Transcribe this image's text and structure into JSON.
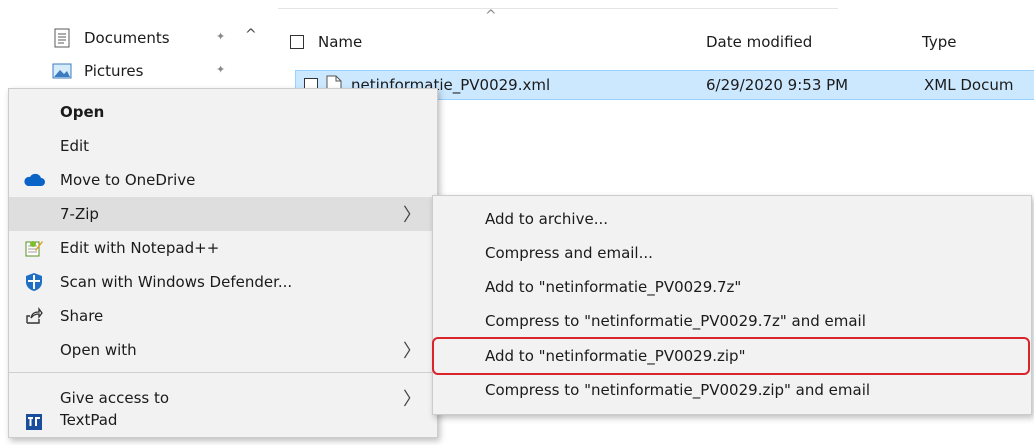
{
  "nav": {
    "items": [
      {
        "label": "Documents",
        "icon": "documents-icon"
      },
      {
        "label": "Pictures",
        "icon": "pictures-icon"
      }
    ],
    "pin_glyph": "📌",
    "scroll_up": "^"
  },
  "columns": {
    "name": "Name",
    "date": "Date modified",
    "type": "Type",
    "sort_caret": "^"
  },
  "file": {
    "name": "netinformatie_PV0029.xml",
    "date": "6/29/2020 9:53 PM",
    "type": "XML Docum"
  },
  "context_menu": {
    "items": [
      {
        "label": "Open",
        "bold": true
      },
      {
        "label": "Edit"
      },
      {
        "label": "Move to OneDrive",
        "icon": "onedrive-icon"
      },
      {
        "label": "7-Zip",
        "has_submenu": true,
        "highlighted": true
      },
      {
        "label": "Edit with Notepad++",
        "icon": "notepadpp-icon"
      },
      {
        "label": "Scan with Windows Defender...",
        "icon": "defender-icon"
      },
      {
        "label": "Share",
        "icon": "share-icon"
      },
      {
        "label": "Open with",
        "has_submenu": true
      },
      {
        "label": "Give access to",
        "has_submenu": true
      },
      {
        "label": "TextPad",
        "icon": "textpad-icon"
      }
    ],
    "arrow": "〉"
  },
  "submenu_7zip": {
    "items": [
      {
        "label": "Add to archive..."
      },
      {
        "label": "Compress and email..."
      },
      {
        "label": "Add to \"netinformatie_PV0029.7z\""
      },
      {
        "label": "Compress to \"netinformatie_PV0029.7z\" and email"
      },
      {
        "label": "Add to \"netinformatie_PV0029.zip\"",
        "annotated": true
      },
      {
        "label": "Compress to \"netinformatie_PV0029.zip\" and email"
      }
    ]
  },
  "colors": {
    "selection_bg": "#cce8ff",
    "selection_border": "#99d1ff",
    "menu_bg": "#f2f2f2",
    "annotation_red": "#d9242a"
  }
}
